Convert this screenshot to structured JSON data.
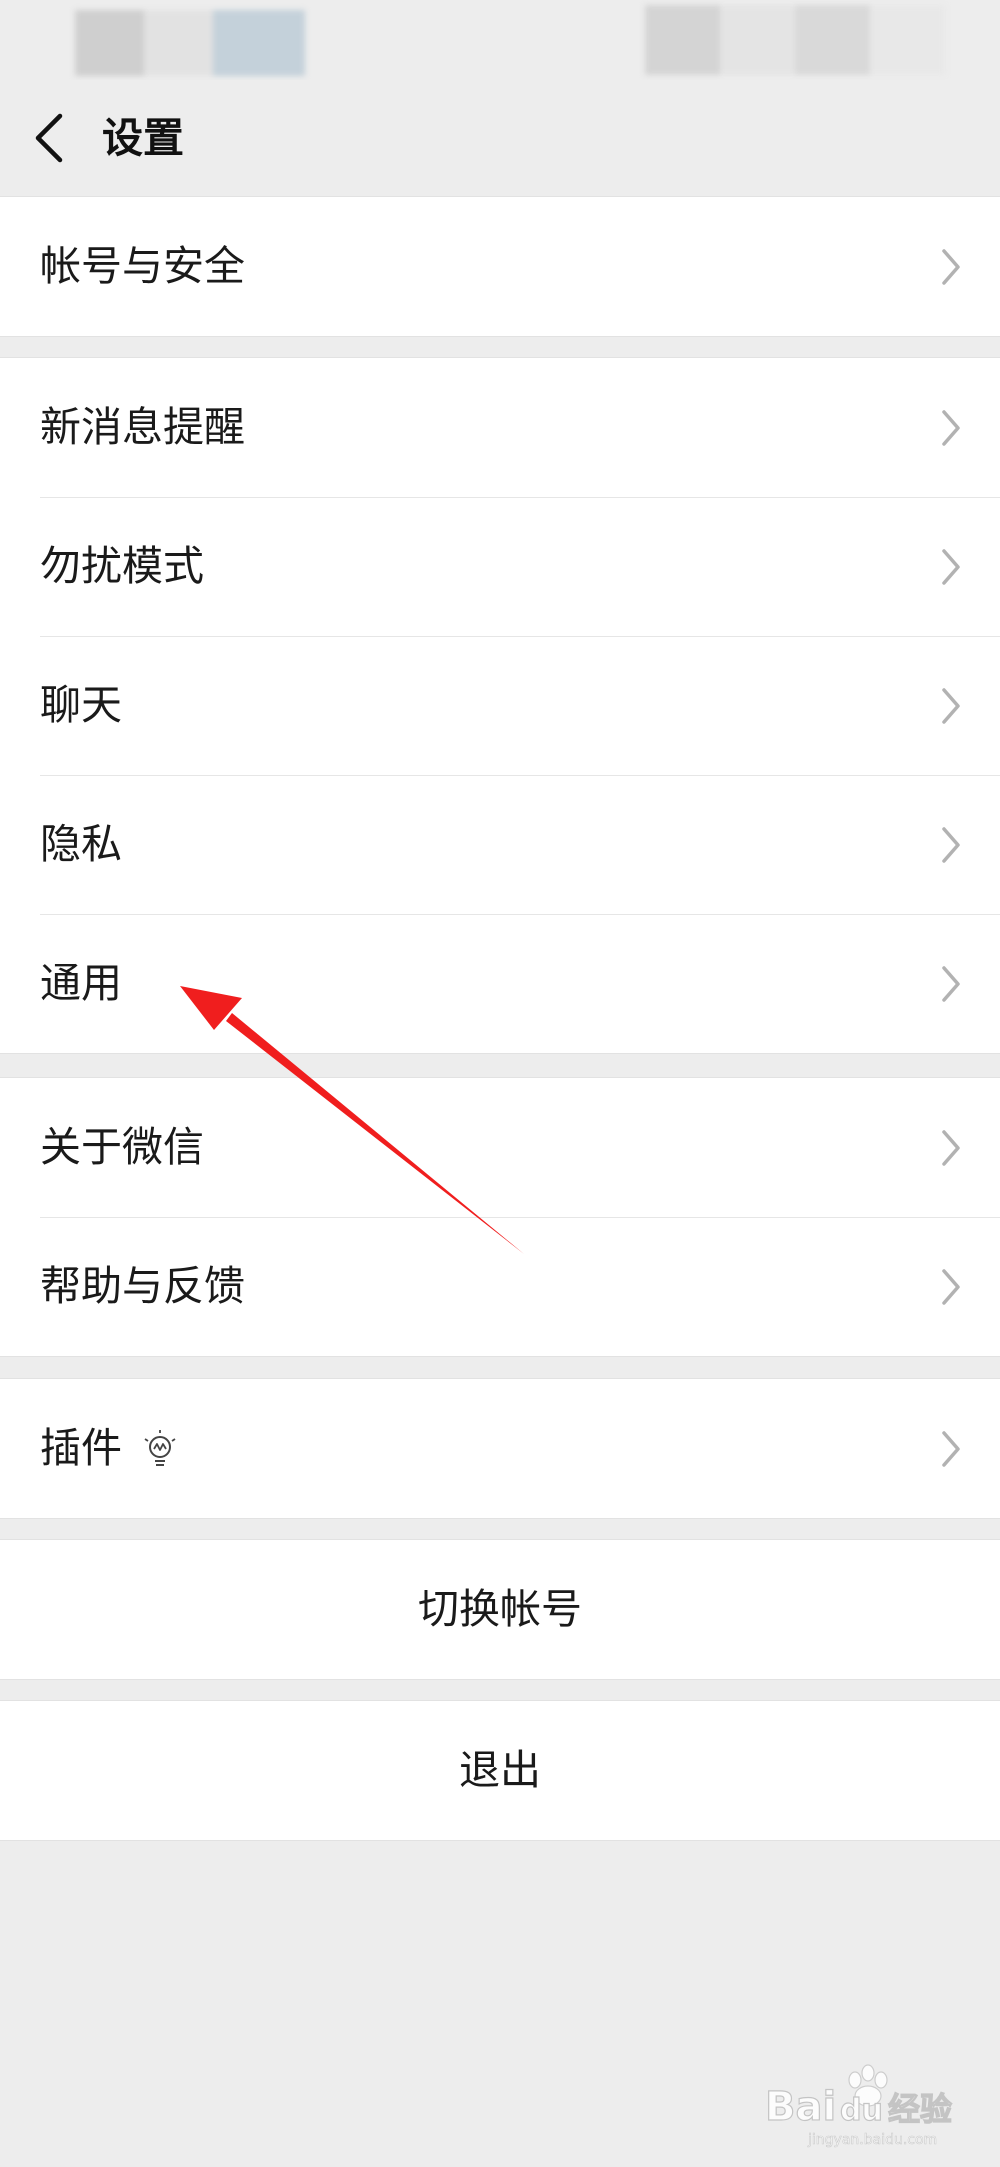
{
  "nav": {
    "title": "设置"
  },
  "groups": {
    "account": {
      "items": [
        {
          "label": "帐号与安全"
        }
      ]
    },
    "main": {
      "items": [
        {
          "label": "新消息提醒"
        },
        {
          "label": "勿扰模式"
        },
        {
          "label": "聊天"
        },
        {
          "label": "隐私"
        },
        {
          "label": "通用"
        }
      ]
    },
    "about": {
      "items": [
        {
          "label": "关于微信"
        },
        {
          "label": "帮助与反馈"
        }
      ]
    },
    "plugins": {
      "items": [
        {
          "label": "插件",
          "icon": "lightbulb-icon"
        }
      ]
    }
  },
  "actions": {
    "switch_account": "切换帐号",
    "logout": "退出"
  },
  "icons": {
    "back": "chevron-left-icon",
    "row_arrow": "chevron-right-icon"
  },
  "annotation": {
    "arrow_color": "#f01e1e",
    "points_to": "通用"
  },
  "watermark": {
    "brand": "Bai",
    "brand_suffix": "du",
    "product": "经验",
    "url": "jingyan.baidu.com"
  },
  "colors": {
    "background": "#ededed",
    "card": "#ffffff",
    "text": "#1a1a1a",
    "chevron": "#b2b2b2"
  }
}
